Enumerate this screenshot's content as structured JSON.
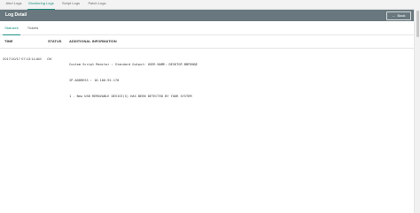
{
  "tabs": [
    {
      "label": "Alert Logs"
    },
    {
      "label": "Monitoring Logs"
    },
    {
      "label": "Script Logs"
    },
    {
      "label": "Patch Logs"
    }
  ],
  "header": {
    "title": "Log Detail",
    "back_label": "Back"
  },
  "subtabs": [
    {
      "label": "Statuses"
    },
    {
      "label": "Tickets"
    }
  ],
  "table": {
    "columns": [
      "TIME",
      "STATUS",
      "ADDITIONAL INFORMATION"
    ],
    "rows": [
      {
        "time": "2017/10/17 07:13:14 AM",
        "status": "OK",
        "info": [
          "Custom Script Monitor : Standard Output: USER NAME: DESKTOP-BBFDNQE",
          "IP-ADDRESS : 10.100.92.178",
          "1 . New USB REMOVABLE DEVICE(S) HAS BEEN DETECTED BY YOUR SYSTEM"
        ]
      }
    ]
  },
  "colors": {
    "accent": "#1a8f7f",
    "header_bg": "#69787e"
  }
}
